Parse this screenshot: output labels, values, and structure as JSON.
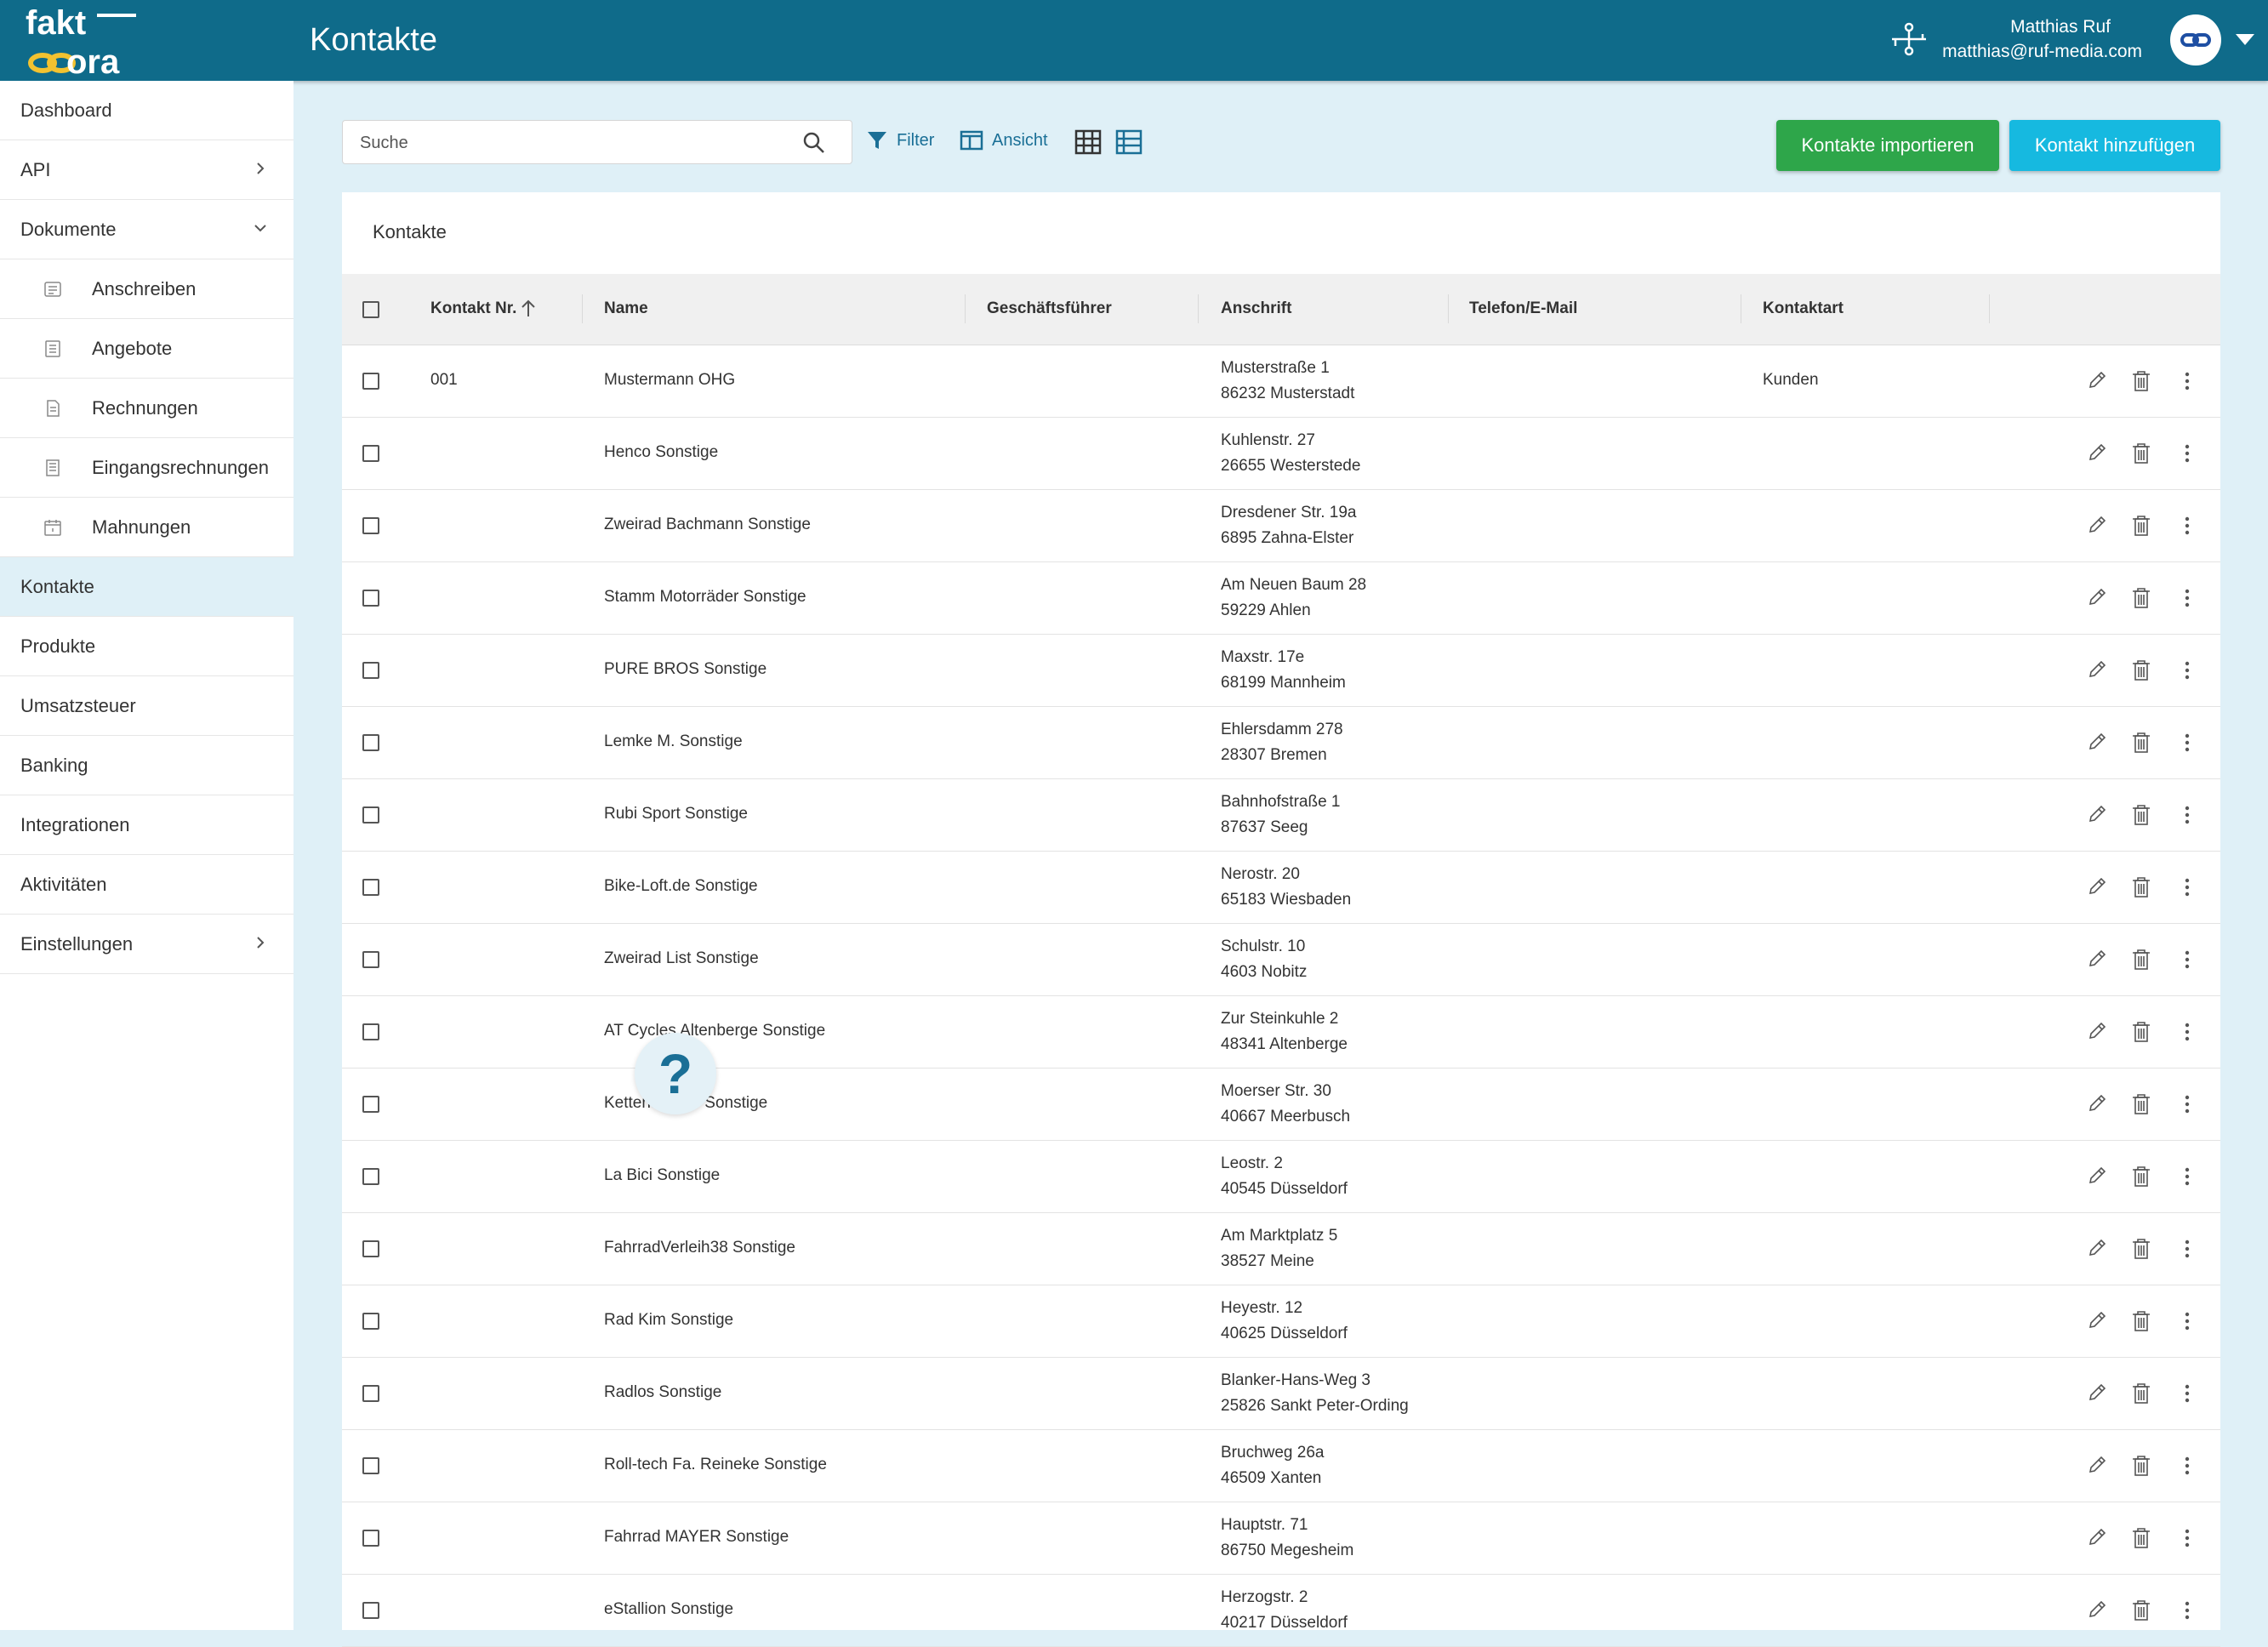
{
  "header": {
    "logo_text_top": "fakt",
    "logo_text_bottom": "ora",
    "title": "Kontakte",
    "user_name": "Matthias Ruf",
    "user_email": "matthias@ruf-media.com"
  },
  "colors": {
    "header_bg": "#0f6b8a",
    "sidebar_active": "#dff0f7",
    "import_button": "#2ea64a",
    "add_button": "#16b9e0",
    "logo_accent": "#f2c230"
  },
  "sidebar": {
    "items": [
      {
        "label": "Dashboard"
      },
      {
        "label": "API",
        "icon": "chevron-right-icon"
      },
      {
        "label": "Dokumente",
        "icon": "chevron-down-icon"
      },
      {
        "label": "Anschreiben",
        "icon": "letter-icon"
      },
      {
        "label": "Angebote",
        "icon": "list-doc-icon"
      },
      {
        "label": "Rechnungen",
        "icon": "invoice-icon"
      },
      {
        "label": "Eingangsrechnungen",
        "icon": "receipt-icon"
      },
      {
        "label": "Mahnungen",
        "icon": "calendar-icon"
      },
      {
        "label": "Kontakte",
        "active": true
      },
      {
        "label": "Produkte"
      },
      {
        "label": "Umsatzsteuer"
      },
      {
        "label": "Banking"
      },
      {
        "label": "Integrationen"
      },
      {
        "label": "Aktivitäten"
      },
      {
        "label": "Einstellungen",
        "icon": "chevron-right-icon"
      }
    ]
  },
  "toolbar": {
    "search_placeholder": "Suche",
    "filter_label": "Filter",
    "view_label": "Ansicht",
    "import_label": "Kontakte importieren",
    "add_label": "Kontakt hinzufügen"
  },
  "table": {
    "title": "Kontakte",
    "columns": [
      "Kontakt Nr.",
      "Name",
      "Geschäftsführer",
      "Anschrift",
      "Telefon/E-Mail",
      "Kontaktart"
    ],
    "rows": [
      {
        "nr": "001",
        "name": "Mustermann OHG",
        "gf": "",
        "addr1": "Musterstraße 1",
        "addr2": "86232 Musterstadt",
        "tel": "",
        "art": "Kunden"
      },
      {
        "nr": "",
        "name": "Henco Sonstige",
        "gf": "",
        "addr1": "Kuhlenstr. 27",
        "addr2": "26655 Westerstede",
        "tel": "",
        "art": ""
      },
      {
        "nr": "",
        "name": "Zweirad Bachmann Sonstige",
        "gf": "",
        "addr1": "Dresdener Str. 19a",
        "addr2": "6895 Zahna-Elster",
        "tel": "",
        "art": ""
      },
      {
        "nr": "",
        "name": "Stamm Motorräder Sonstige",
        "gf": "",
        "addr1": "Am Neuen Baum 28",
        "addr2": "59229 Ahlen",
        "tel": "",
        "art": ""
      },
      {
        "nr": "",
        "name": "PURE BROS Sonstige",
        "gf": "",
        "addr1": "Maxstr. 17e",
        "addr2": "68199 Mannheim",
        "tel": "",
        "art": ""
      },
      {
        "nr": "",
        "name": "Lemke M. Sonstige",
        "gf": "",
        "addr1": "Ehlersdamm 278",
        "addr2": "28307 Bremen",
        "tel": "",
        "art": ""
      },
      {
        "nr": "",
        "name": "Rubi Sport Sonstige",
        "gf": "",
        "addr1": "Bahnhofstraße 1",
        "addr2": "87637 Seeg",
        "tel": "",
        "art": ""
      },
      {
        "nr": "",
        "name": "Bike-Loft.de Sonstige",
        "gf": "",
        "addr1": "Nerostr. 20",
        "addr2": "65183 Wiesbaden",
        "tel": "",
        "art": ""
      },
      {
        "nr": "",
        "name": "Zweirad List Sonstige",
        "gf": "",
        "addr1": "Schulstr. 10",
        "addr2": "4603 Nobitz",
        "tel": "",
        "art": ""
      },
      {
        "nr": "",
        "name": "AT Cycles Altenberge Sonstige",
        "gf": "",
        "addr1": "Zur Steinkuhle 2",
        "addr2": "48341 Altenberge",
        "tel": "",
        "art": ""
      },
      {
        "nr": "",
        "name": "Kettenantrieb Sonstige",
        "gf": "",
        "addr1": "Moerser Str. 30",
        "addr2": "40667 Meerbusch",
        "tel": "",
        "art": ""
      },
      {
        "nr": "",
        "name": "La Bici Sonstige",
        "gf": "",
        "addr1": "Leostr. 2",
        "addr2": "40545 Düsseldorf",
        "tel": "",
        "art": ""
      },
      {
        "nr": "",
        "name": "FahrradVerleih38 Sonstige",
        "gf": "",
        "addr1": "Am Marktplatz 5",
        "addr2": "38527 Meine",
        "tel": "",
        "art": ""
      },
      {
        "nr": "",
        "name": "Rad Kim Sonstige",
        "gf": "",
        "addr1": "Heyestr. 12",
        "addr2": "40625 Düsseldorf",
        "tel": "",
        "art": ""
      },
      {
        "nr": "",
        "name": "Radlos Sonstige",
        "gf": "",
        "addr1": "Blanker-Hans-Weg 3",
        "addr2": "25826 Sankt Peter-Ording",
        "tel": "",
        "art": ""
      },
      {
        "nr": "",
        "name": "Roll-tech Fa. Reineke Sonstige",
        "gf": "",
        "addr1": "Bruchweg 26a",
        "addr2": "46509 Xanten",
        "tel": "",
        "art": ""
      },
      {
        "nr": "",
        "name": "Fahrrad MAYER Sonstige",
        "gf": "",
        "addr1": "Hauptstr. 71",
        "addr2": "86750 Megesheim",
        "tel": "",
        "art": ""
      },
      {
        "nr": "",
        "name": "eStallion Sonstige",
        "gf": "",
        "addr1": "Herzogstr. 2",
        "addr2": "40217 Düsseldorf",
        "tel": "",
        "art": ""
      }
    ]
  },
  "help": {
    "label": "?"
  }
}
